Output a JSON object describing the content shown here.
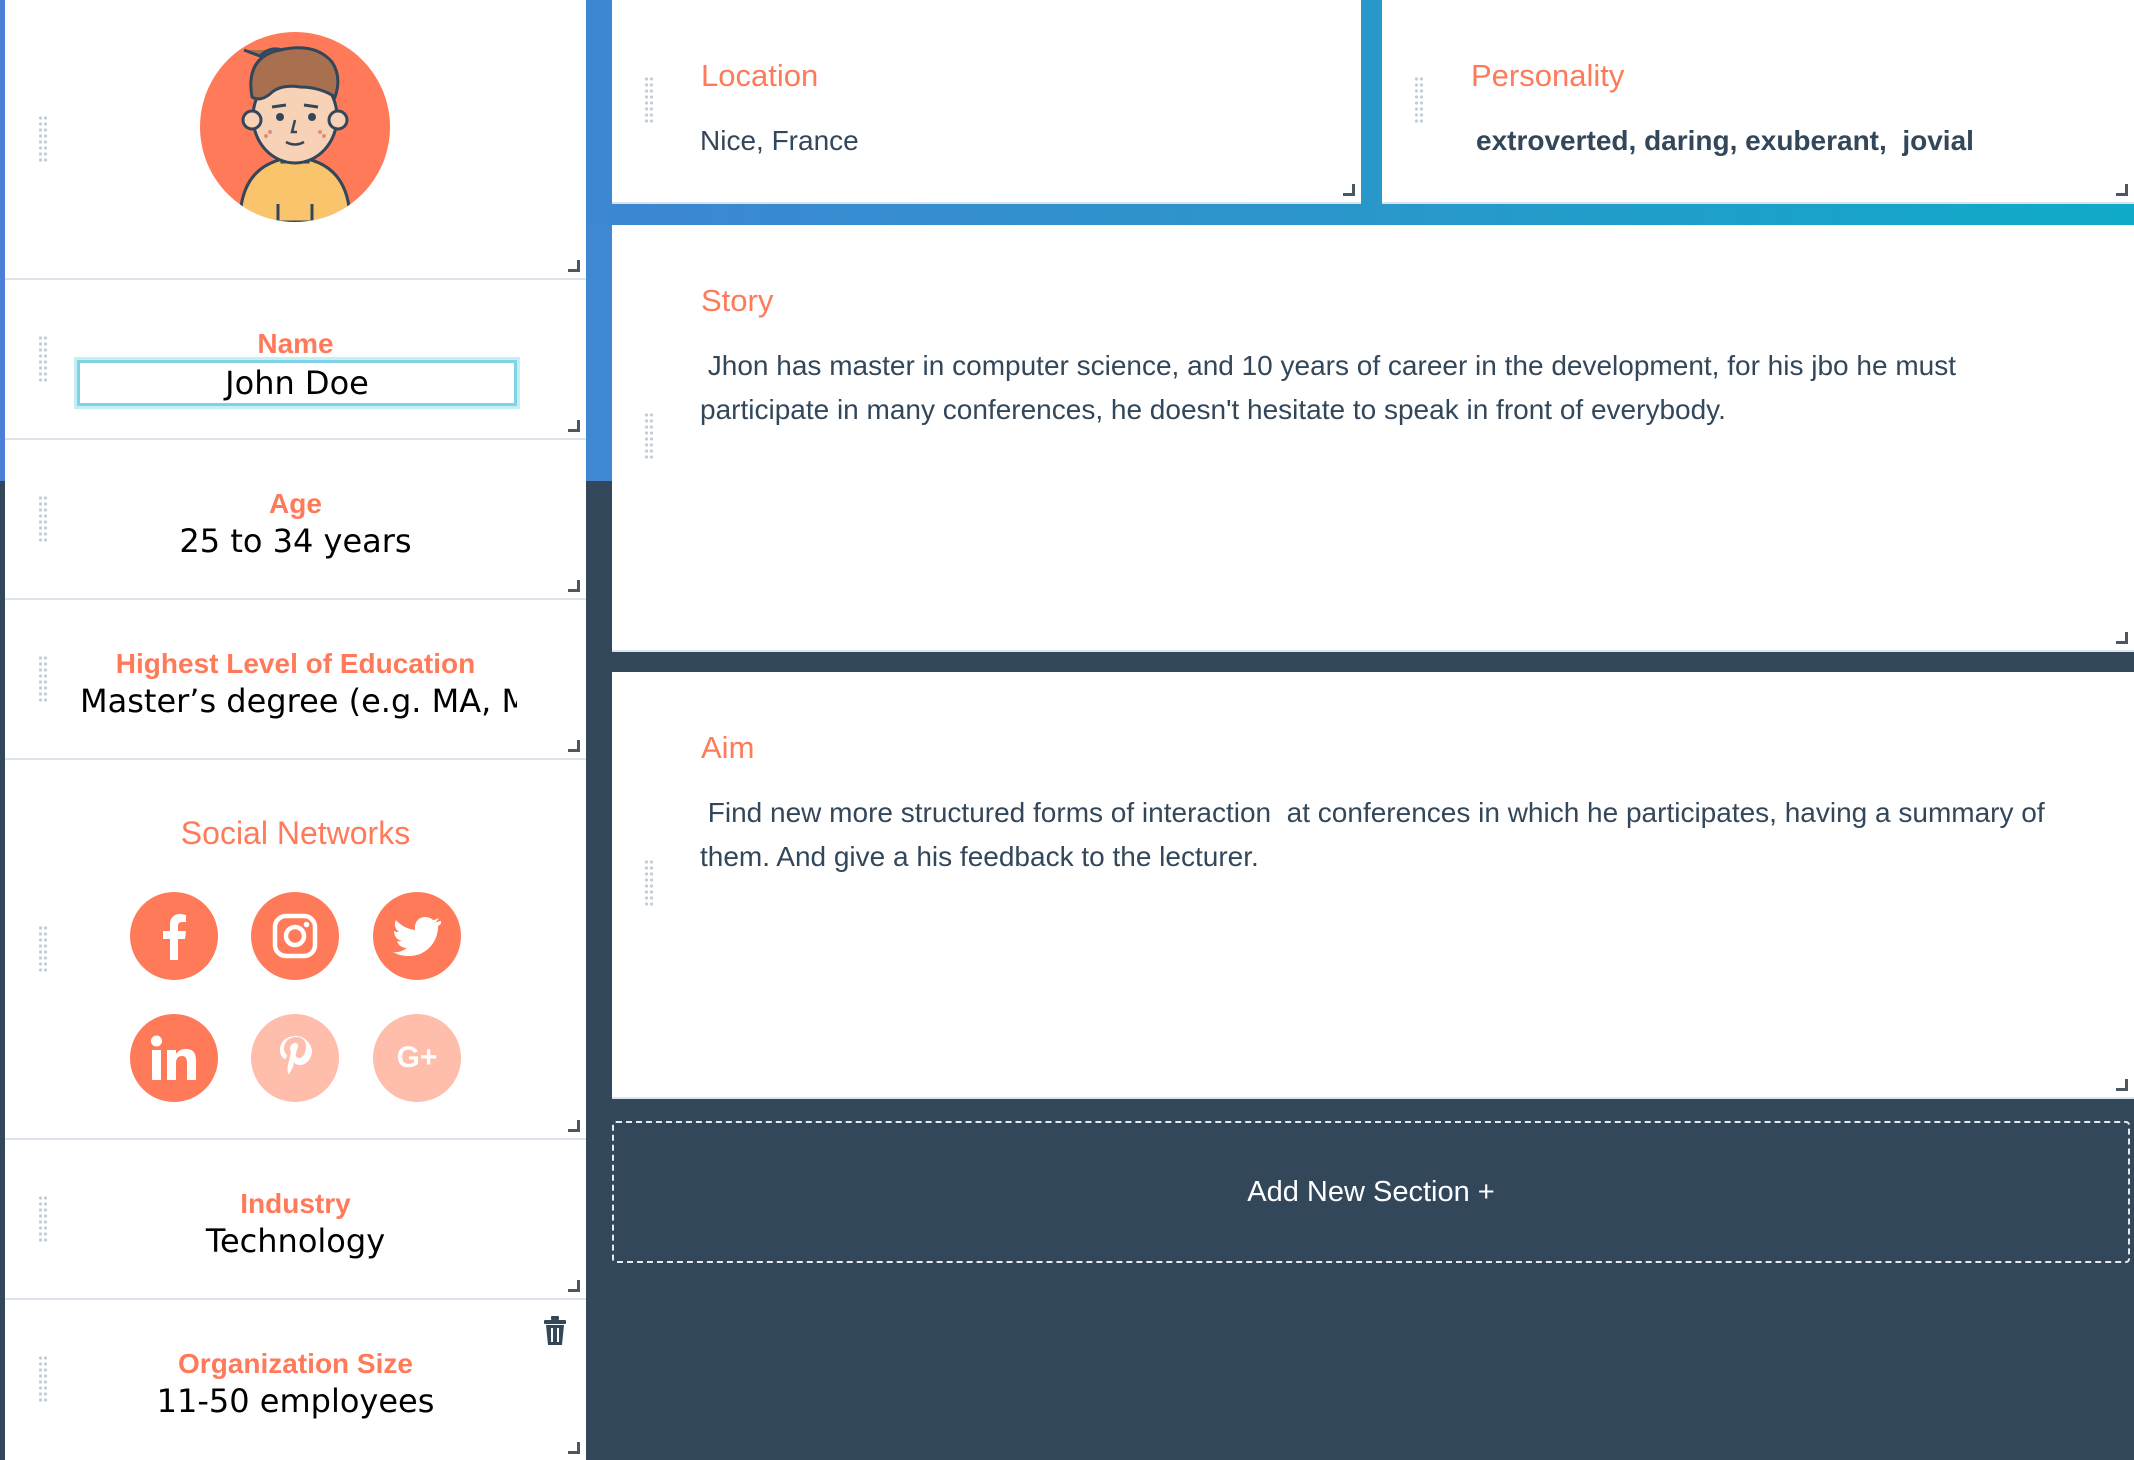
{
  "profile": {
    "avatar_icon": "user-avatar-icon",
    "name": {
      "label": "Name",
      "value": "John Doe"
    },
    "age": {
      "label": "Age",
      "value": "25 to 34 years"
    },
    "education": {
      "label": "Highest Level of Education",
      "value": "Master’s degree (e.g. MA, MS"
    },
    "social": {
      "label": "Social Networks",
      "networks": [
        {
          "name": "facebook-icon",
          "active": true
        },
        {
          "name": "instagram-icon",
          "active": true
        },
        {
          "name": "twitter-icon",
          "active": true
        },
        {
          "name": "linkedin-icon",
          "active": true
        },
        {
          "name": "pinterest-icon",
          "active": false
        },
        {
          "name": "google-plus-icon",
          "active": false
        }
      ],
      "google_plus_text": "G+"
    },
    "industry": {
      "label": "Industry",
      "value": "Technology"
    },
    "org_size": {
      "label": "Organization Size",
      "value": "11-50 employees"
    }
  },
  "location": {
    "title": "Location",
    "text": "Nice, France"
  },
  "personality": {
    "title": "Personality",
    "text": "extroverted, daring, exuberant,  jovial"
  },
  "story": {
    "title": "Story",
    "text": " Jhon has master in computer science, and 10 years of career in the development, for his jbo he must participate in many conferences, he doesn't hesitate to speak in front of everybody."
  },
  "aim": {
    "title": "Aim",
    "text": " Find new more structured forms of interaction  at conferences in which he participates, having a summary of them. And give a his feedback to the lecturer."
  },
  "add_section": {
    "label": "Add New Section +"
  },
  "colors": {
    "accent": "#ff7a59",
    "accent_light": "#ffbdac",
    "dark_bg": "#33475b",
    "input_focus": "#7fd3e4"
  }
}
